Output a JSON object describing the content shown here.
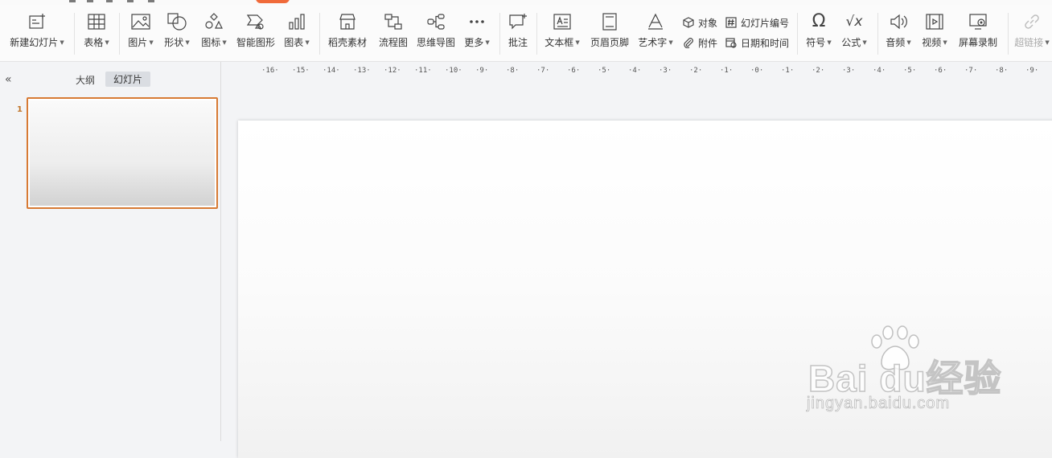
{
  "ribbon": {
    "new_slide": "新建幻灯片",
    "table": "表格",
    "picture": "图片",
    "shape": "形状",
    "icon": "图标",
    "smart_graphic": "智能图形",
    "chart": "图表",
    "docer_material": "稻壳素材",
    "flowchart": "流程图",
    "mind_map": "思维导图",
    "more": "更多",
    "comment": "批注",
    "text_box": "文本框",
    "header_footer": "页眉页脚",
    "word_art": "艺术字",
    "object": "对象",
    "attachment": "附件",
    "slide_number": "幻灯片编号",
    "date_time": "日期和时间",
    "symbol": "符号",
    "formula": "公式",
    "audio": "音频",
    "video": "视频",
    "screen_record": "屏幕录制",
    "hyperlink": "超链接"
  },
  "left_panel": {
    "tab_outline": "大纲",
    "tab_slides": "幻灯片",
    "collapse_glyph": "«",
    "slide_number": "1"
  },
  "ruler": {
    "labels": [
      "16",
      "15",
      "14",
      "13",
      "12",
      "11",
      "10",
      "9",
      "8",
      "7",
      "6",
      "5",
      "4",
      "3",
      "2",
      "1",
      "0",
      "1",
      "2",
      "3",
      "4",
      "5",
      "6",
      "7",
      "8",
      "9"
    ]
  },
  "watermark": {
    "brand": "Bai  du经验",
    "url": "jingyan.baidu.com"
  },
  "colors": {
    "accent": "#f06a3a",
    "thumb_border": "#d77a34"
  }
}
